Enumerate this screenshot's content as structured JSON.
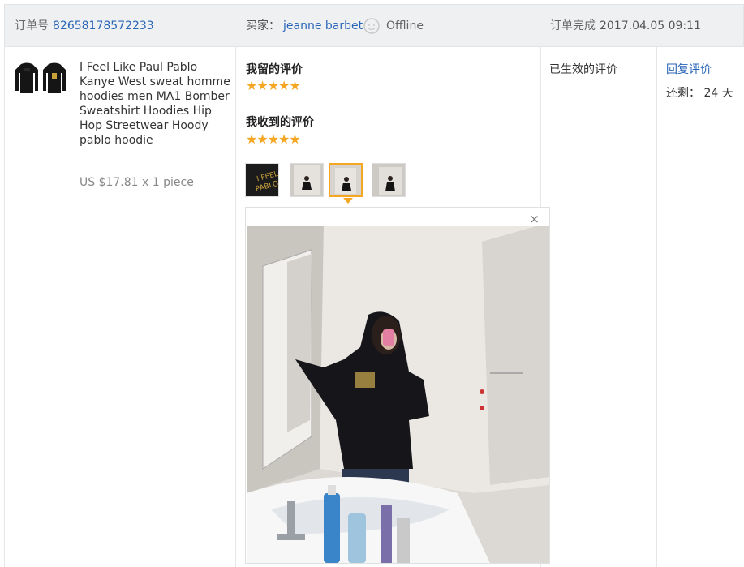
{
  "order": {
    "number_label": "订单号",
    "number_value": "82658178572233",
    "buyer_label": "买家：",
    "buyer_name": "jeanne barbet",
    "buyer_status": "Offline",
    "completed_label": "订单完成",
    "completed_time": "2017.04.05 09:11"
  },
  "product": {
    "title": "I Feel Like Paul Pablo Kanye West sweat homme hoodies men MA1 Bomber Sweatshirt Hoodies Hip Hop Streetwear Hoody pablo hoodie",
    "price": "US $17.81 x 1 piece",
    "images": [
      "hoodie-back",
      "hoodie-front"
    ]
  },
  "feedback": {
    "my_review_label": "我留的评价",
    "my_review_stars": "★★★★★",
    "received_review_label": "我收到的评价",
    "received_review_stars": "★★★★★",
    "thumbs": [
      "hoodie-print",
      "mirror-selfie-1",
      "mirror-selfie-2",
      "mirror-selfie-3"
    ],
    "selected_thumb": 3,
    "close_glyph": "×"
  },
  "status": {
    "effective_label": "已生效的评价"
  },
  "actions": {
    "reply_label": "回复评价",
    "remaining": "还剩： 24 天"
  },
  "colors": {
    "link": "#2a66b8",
    "star": "#f5a623",
    "header_bg": "#eef0f2"
  }
}
